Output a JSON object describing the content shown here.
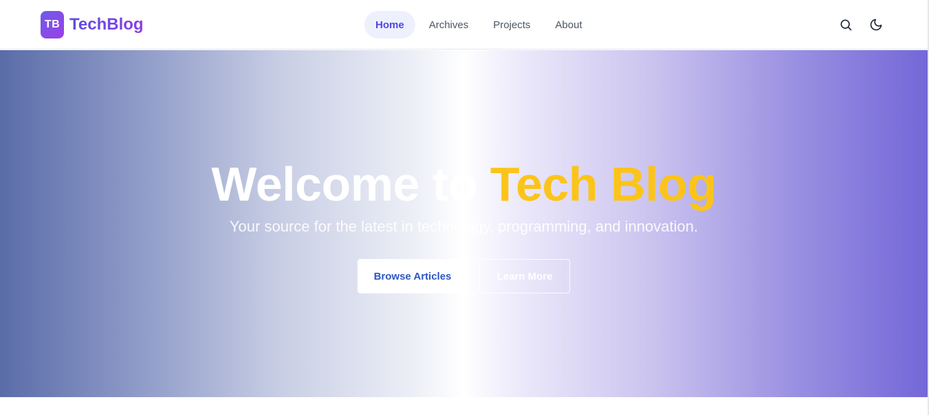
{
  "brand": {
    "badge": "TB",
    "name": "TechBlog"
  },
  "nav": {
    "items": [
      {
        "label": "Home",
        "active": true
      },
      {
        "label": "Archives",
        "active": false
      },
      {
        "label": "Projects",
        "active": false
      },
      {
        "label": "About",
        "active": false
      }
    ]
  },
  "tools": {
    "search_icon": "search-icon",
    "theme_icon": "moon-icon"
  },
  "hero": {
    "title_plain": "Welcome to ",
    "title_accent": "Tech Blog",
    "subtitle": "Your source for the latest in technology, programming, and innovation.",
    "primary_cta": "Browse Articles",
    "secondary_cta": "Learn More"
  },
  "colors": {
    "brand": "#5b4fe0",
    "accent": "#fcc419",
    "nav_active_bg": "#eef0fd",
    "nav_active_text": "#4f46e5",
    "primary_btn_text": "#2d56c6"
  }
}
